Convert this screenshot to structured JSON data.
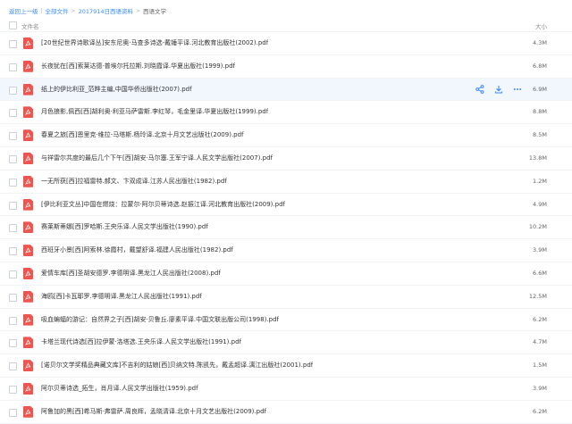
{
  "breadcrumb": {
    "back": "返回上一级",
    "sep1": "|",
    "all_files": "全部文件",
    "sep2": ">",
    "folder1": "2017914日西语资料",
    "sep3": ">",
    "current": "西语文学"
  },
  "header": {
    "name_col": "文件名",
    "size_col": "大小"
  },
  "files": [
    {
      "name": "[20世纪世界诗歌译丛]安东尼奥·马查多诗选-戴锤平译.河北教育出版社(2002).pdf",
      "size": "4.3M"
    },
    {
      "name": "长夜犹在[西]索莱达德·普埃尔托拉斯.刘晓霞译.华夏出版社(1999).pdf",
      "size": "6.8M"
    },
    {
      "name": "纸上的伊比利亚_范晔主编,中国华侨出版社(2007).pdf",
      "size": "6.9M"
    },
    {
      "name": "月色狼影,佩西[西]胡利奥·利亚马萨雷斯.李红琴，毛金里译.华夏出版社(1999).pdf",
      "size": "8.8M"
    },
    {
      "name": "春夏之旅[西]恩里克·维拉-马塔斯.杨玲译.北京十月文艺出版社(2009).pdf",
      "size": "8.5M"
    },
    {
      "name": "与祥雷尔共度的最后几个下午[西]胡安·马尔塞.王军宁译.人民文学出版社(2007).pdf",
      "size": "13.8M"
    },
    {
      "name": "一无所获[西]拉福雷特.郝文、卞双成译.江苏人民出版社(1982).pdf",
      "size": "1.2M"
    },
    {
      "name": "[伊比利亚文丛]中国在燃烧：拉蒙尔·阿尔贝蒂诗选.赵振江译.河北教育出版社(2009).pdf",
      "size": "4.9M"
    },
    {
      "name": "赛莱斯蒂娜[西]罗哈斯.王央乐译.人民文学出版社(1990).pdf",
      "size": "10.2M"
    },
    {
      "name": "西班牙小景[西]阿索林.徐霞村，戴望舒译.福建人民出版社(1982).pdf",
      "size": "3.9M"
    },
    {
      "name": "爱情车库[西]圣胡安德罗.李德明译.黑龙江人民出版社(2008).pdf",
      "size": "6.6M"
    },
    {
      "name": "海鸥[西]卡瓦耶罗.李德明译.黑龙江人民出版社(1991).pdf",
      "size": "12.5M"
    },
    {
      "name": "吸血蝙蝠的游记：自然界之子[西]胡安·贝鲁丘.廖素平译.中国文联出版公司(1998).pdf",
      "size": "6.2M"
    },
    {
      "name": "卡塔兰现代诗选[西]拉伊蒙·洛塔选.王央乐译.人民文学出版社(1991).pdf",
      "size": "4.7M"
    },
    {
      "name": "[诺贝尔文学奖精品典藏文库]不吉利的姑娘[西]贝纳文特.陈凯先，戴孟超译.漓江出版社(2001).pdf",
      "size": "1.5M"
    },
    {
      "name": "阿尔贝蒂诗选_拓生，肖月译.人民文学出版社(1959).pdf",
      "size": "3.9M"
    },
    {
      "name": "阿鲁加的黑[西]希马斯·弗雷萨.周良辉，孟晓清译.北京十月文艺出版社(2009).pdf",
      "size": "6.2M"
    }
  ],
  "actions": {
    "share_icon": "share-icon",
    "download_icon": "download-icon",
    "more_icon": "more-icon"
  },
  "colors": {
    "link": "#3b8cff",
    "pdf_red": "#f0544f",
    "hover_row": "#f2f6fd",
    "action_blue": "#3b8cff"
  }
}
